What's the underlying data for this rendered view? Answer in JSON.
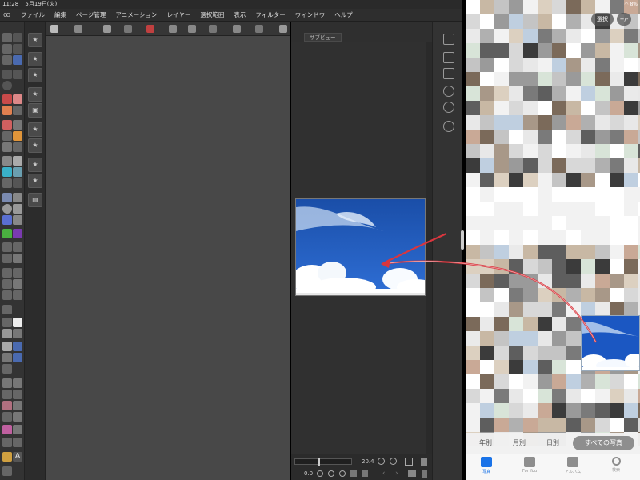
{
  "status": {
    "time": "11:28",
    "date": "5月19日(火)",
    "battery": "8%"
  },
  "menu": [
    "ファイル",
    "編集",
    "ページ管理",
    "アニメーション",
    "レイヤー",
    "選択範囲",
    "表示",
    "フィルター",
    "ウィンドウ",
    "ヘルプ"
  ],
  "subview": {
    "tab_label": "サブビュー",
    "zoom_value": "20.4",
    "rotate_value": "0.0"
  },
  "photos": {
    "select_label": "選択",
    "zoom_label": "+/-",
    "segments": [
      {
        "label": "年別",
        "active": false
      },
      {
        "label": "月別",
        "active": false
      },
      {
        "label": "日別",
        "active": false
      },
      {
        "label": "すべての写真",
        "active": true
      }
    ],
    "tabs": [
      {
        "label": "写真",
        "icon": "photos-icon",
        "active": true
      },
      {
        "label": "For You",
        "icon": "for-you-icon",
        "active": false
      },
      {
        "label": "アルバム",
        "icon": "albums-icon",
        "active": false
      },
      {
        "label": "検索",
        "icon": "search-icon",
        "active": false
      }
    ]
  },
  "colors": {
    "accent": "#1a73e8",
    "arrow": "#d9363e",
    "sky": "#1f4aa0"
  }
}
